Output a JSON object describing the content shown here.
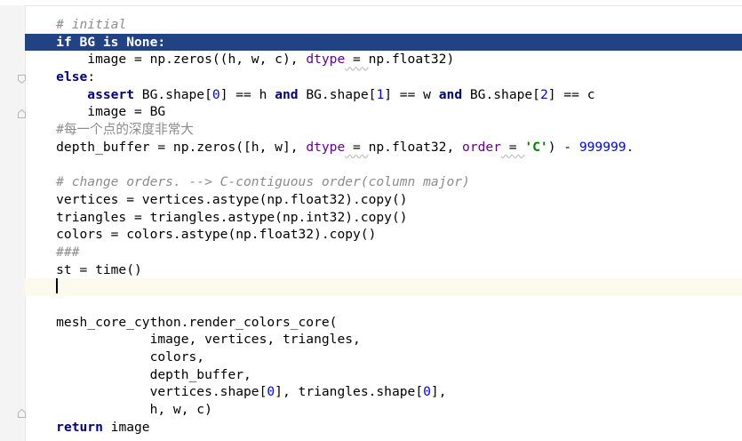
{
  "editor": {
    "lines": [
      [
        {
          "t": "    "
        },
        {
          "t": "# initial",
          "c": "c"
        }
      ],
      [
        {
          "t": "    "
        },
        {
          "t": "if BG is None:"
        }
      ],
      [
        {
          "t": "        image = np.zeros((h, w, c), "
        },
        {
          "t": "dtype",
          "c": "p"
        },
        {
          "t": " = ",
          "c": "eq"
        },
        {
          "t": "np.float32)"
        }
      ],
      [
        {
          "t": "    "
        },
        {
          "t": "else",
          "c": "k"
        },
        {
          "t": ":"
        }
      ],
      [
        {
          "t": "        "
        },
        {
          "t": "assert",
          "c": "k"
        },
        {
          "t": " BG.shape["
        },
        {
          "t": "0",
          "c": "n"
        },
        {
          "t": "] == h "
        },
        {
          "t": "and",
          "c": "k"
        },
        {
          "t": " BG.shape["
        },
        {
          "t": "1",
          "c": "n"
        },
        {
          "t": "] == w "
        },
        {
          "t": "and",
          "c": "k"
        },
        {
          "t": " BG.shape["
        },
        {
          "t": "2",
          "c": "n"
        },
        {
          "t": "] == c"
        }
      ],
      [
        {
          "t": "        image = BG"
        }
      ],
      [
        {
          "t": "    "
        },
        {
          "t": "#每一个点的深度非常大",
          "c": "c2"
        }
      ],
      [
        {
          "t": "    depth_buffer = np.zeros([h, w], "
        },
        {
          "t": "dtype",
          "c": "p"
        },
        {
          "t": " = ",
          "c": "eq"
        },
        {
          "t": "np.float32, "
        },
        {
          "t": "order",
          "c": "p"
        },
        {
          "t": " = ",
          "c": "eq"
        },
        {
          "t": "'C'",
          "c": "s"
        },
        {
          "t": ") - "
        },
        {
          "t": "999999.",
          "c": "n"
        }
      ],
      [
        {
          "t": ""
        }
      ],
      [
        {
          "t": "    "
        },
        {
          "t": "# change orders. --> C-contiguous order(column major)",
          "c": "c"
        }
      ],
      [
        {
          "t": "    vertices = vertices.astype(np.float32).copy()"
        }
      ],
      [
        {
          "t": "    triangles = triangles.astype(np.int32).copy()"
        }
      ],
      [
        {
          "t": "    colors = colors.astype(np.float32).copy()"
        }
      ],
      [
        {
          "t": "    "
        },
        {
          "t": "###",
          "c": "c"
        }
      ],
      [
        {
          "t": "    st = time()"
        }
      ],
      [
        {
          "t": "    "
        }
      ],
      [
        {
          "t": ""
        }
      ],
      [
        {
          "t": "    mesh_core_cython.render_colors_core("
        }
      ],
      [
        {
          "t": "                image, vertices, triangles,"
        }
      ],
      [
        {
          "t": "                colors,"
        }
      ],
      [
        {
          "t": "                depth_buffer,"
        }
      ],
      [
        {
          "t": "                vertices.shape["
        },
        {
          "t": "0",
          "c": "n"
        },
        {
          "t": "], triangles.shape["
        },
        {
          "t": "0",
          "c": "n"
        },
        {
          "t": "],"
        }
      ],
      [
        {
          "t": "                h, w, c)"
        }
      ],
      [
        {
          "t": "    "
        },
        {
          "t": "return",
          "c": "k"
        },
        {
          "t": " image"
        }
      ]
    ],
    "selected_line": 1,
    "caret_line": 15
  }
}
